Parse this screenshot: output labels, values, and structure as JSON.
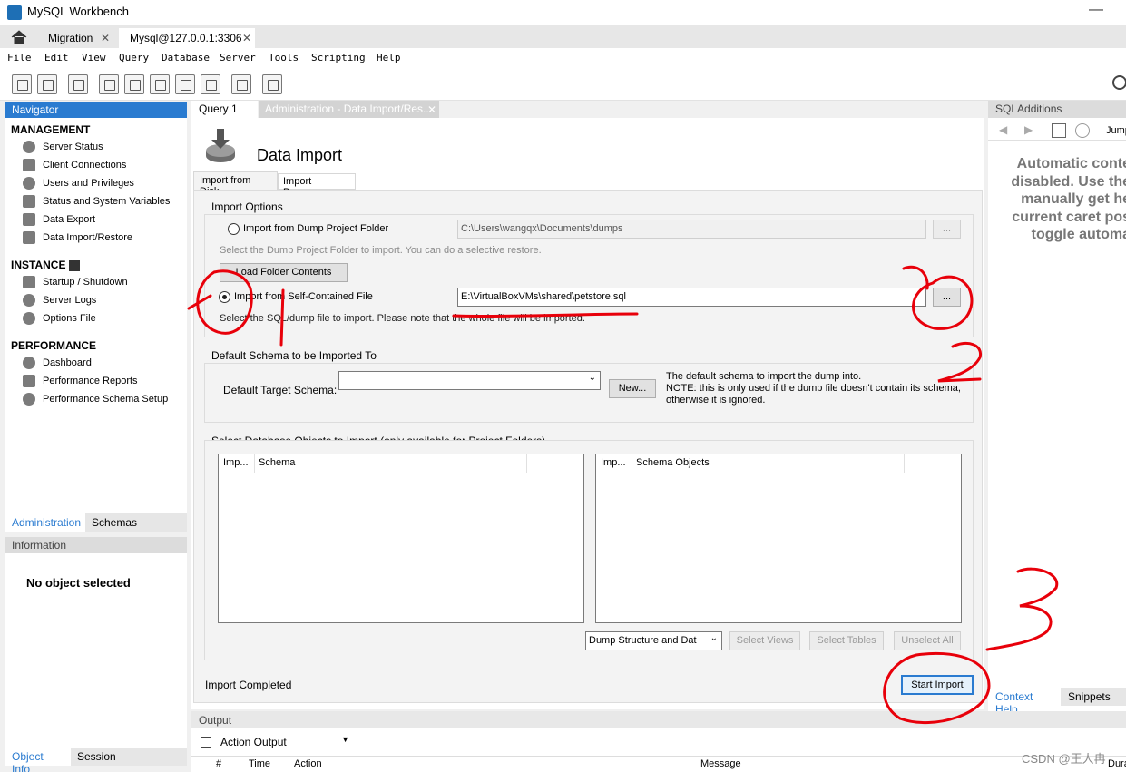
{
  "window": {
    "title": "MySQL Workbench"
  },
  "tabs": [
    {
      "label": "Migration"
    },
    {
      "label": "Mysql@127.0.0.1:3306"
    }
  ],
  "menu": [
    "File",
    "Edit",
    "View",
    "Query",
    "Database",
    "Server",
    "Tools",
    "Scripting",
    "Help"
  ],
  "navigator": {
    "title": "Navigator",
    "management": {
      "title": "MANAGEMENT",
      "items": [
        "Server Status",
        "Client Connections",
        "Users and Privileges",
        "Status and System Variables",
        "Data Export",
        "Data Import/Restore"
      ]
    },
    "instance": {
      "title": "INSTANCE",
      "items": [
        "Startup / Shutdown",
        "Server Logs",
        "Options File"
      ]
    },
    "performance": {
      "title": "PERFORMANCE",
      "items": [
        "Dashboard",
        "Performance Reports",
        "Performance Schema Setup"
      ]
    },
    "tabs": [
      "Administration",
      "Schemas"
    ]
  },
  "information": {
    "title": "Information",
    "empty": "No object selected",
    "tabs": [
      "Object Info",
      "Session"
    ]
  },
  "editor_tabs": [
    "Query 1",
    "Administration - Data Import/Res..."
  ],
  "data_import": {
    "title": "Data Import",
    "tabs": [
      "Import from Disk",
      "Import Progress"
    ],
    "import_options": {
      "title": "Import Options",
      "opt_folder": "Import from Dump Project Folder",
      "folder_path": "C:\\Users\\wangqx\\Documents\\dumps",
      "folder_hint": "Select the Dump Project Folder to import. You can do a selective restore.",
      "load_button": "Load Folder Contents",
      "opt_file": "Import from Self-Contained File",
      "file_path": "E:\\VirtualBoxVMs\\shared\\petstore.sql",
      "file_hint": "Select the SQL/dump file to import. Please note that the whole file will be imported.",
      "browse": "..."
    },
    "schema": {
      "title": "Default Schema to be Imported To",
      "label": "Default Target Schema:",
      "value": "",
      "new_button": "New...",
      "note1": "The default schema to import the dump into.",
      "note2": "NOTE: this is only used if the dump file doesn't contain its schema,",
      "note3": "otherwise it is ignored."
    },
    "objects": {
      "title": "Select Database Objects to Import (only available for Project Folders)",
      "left_cols": [
        "Imp...",
        "Schema"
      ],
      "right_cols": [
        "Imp...",
        "Schema Objects"
      ],
      "dump_select": "Dump Structure and Dat",
      "select_views": "Select Views",
      "select_tables": "Select Tables",
      "unselect_all": "Unselect All"
    },
    "status": "Import Completed",
    "start_button": "Start Import"
  },
  "sql_additions": {
    "title": "SQLAdditions",
    "jump": "Jump",
    "message_lines": [
      "Automatic conte",
      "disabled. Use the",
      "manually get he",
      "current caret pos",
      "toggle automa"
    ],
    "tabs": [
      "Context Help",
      "Snippets"
    ]
  },
  "output": {
    "title": "Output",
    "selector": "Action Output",
    "columns": [
      "#",
      "Time",
      "Action",
      "Message",
      "Dura"
    ]
  },
  "watermark": "CSDN @王人冉",
  "annotations": [
    "1",
    "2",
    "3"
  ],
  "colors": {
    "accent": "#2a7bd0",
    "annotation": "#e8000a"
  }
}
